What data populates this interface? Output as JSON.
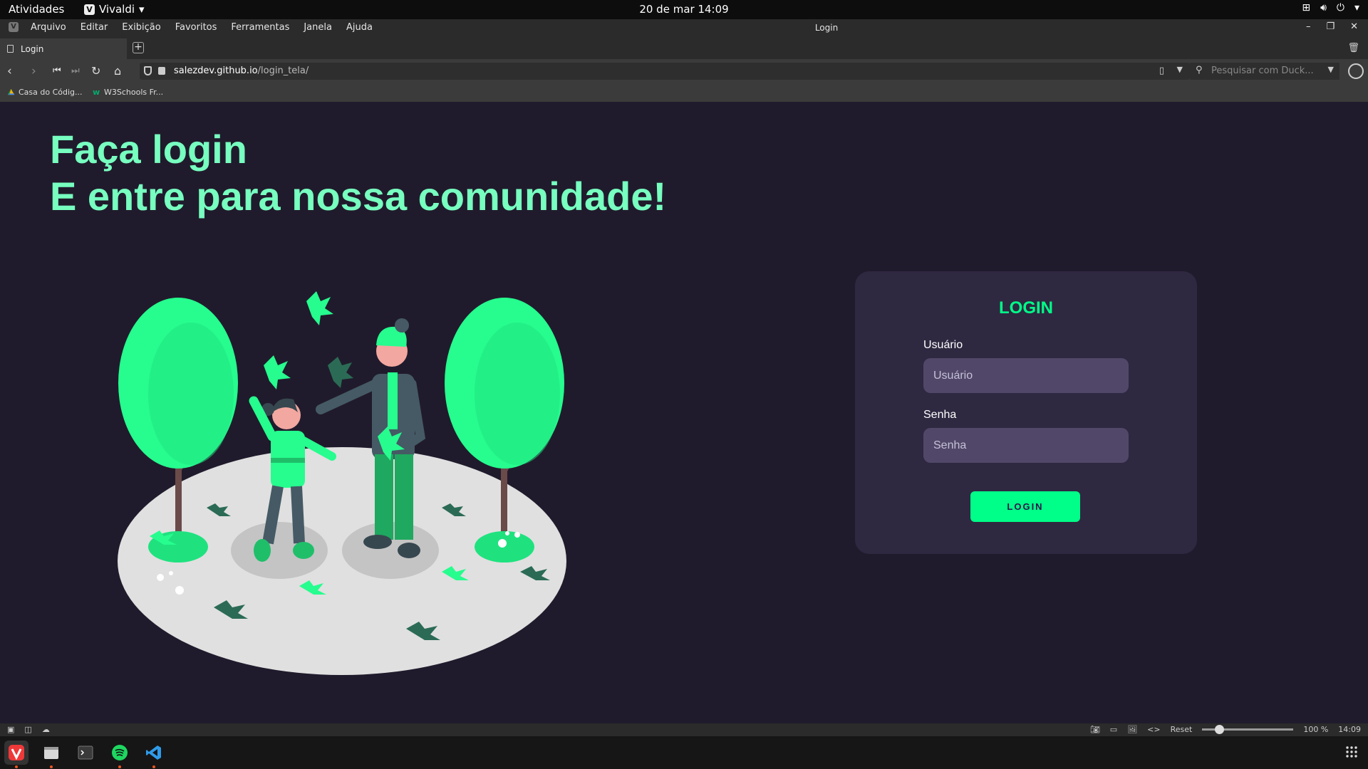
{
  "system_bar": {
    "activities": "Atividades",
    "app_name": "Vivaldi",
    "clock": "20 de mar  14:09"
  },
  "menubar": {
    "items": [
      "Arquivo",
      "Editar",
      "Exibição",
      "Favoritos",
      "Ferramentas",
      "Janela",
      "Ajuda"
    ],
    "window_title": "Login"
  },
  "tab": {
    "title": "Login"
  },
  "address": {
    "url_domain": "salezdev.github.io",
    "url_path": "/login_tela/",
    "search_placeholder": "Pesquisar com Duck..."
  },
  "bookmarks": [
    "Casa do Códig...",
    "W3Schools Fr..."
  ],
  "page": {
    "heading_line1": "Faça login",
    "heading_line2": "E entre para nossa comunidade!",
    "login": {
      "title": "LOGIN",
      "user_label": "Usuário",
      "user_placeholder": "Usuário",
      "pass_label": "Senha",
      "pass_placeholder": "Senha",
      "button": "LOGIN"
    }
  },
  "statusbar": {
    "reset": "Reset",
    "zoom": "100 %",
    "time": "14:09"
  },
  "colors": {
    "accent": "#00ff88",
    "heading": "#77ffc0",
    "background": "#201b2c",
    "card": "#2f2841",
    "input": "#514869"
  }
}
